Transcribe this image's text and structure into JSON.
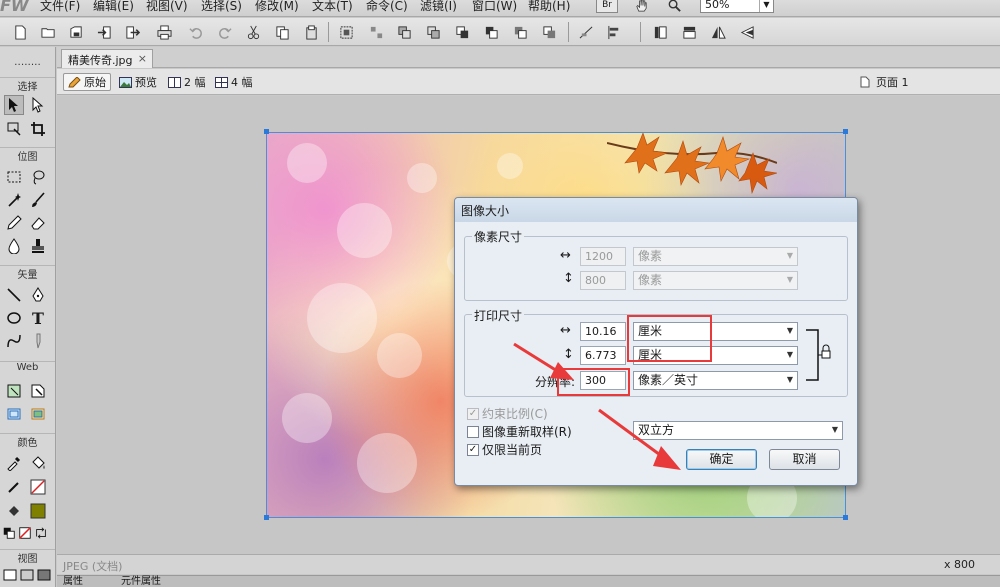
{
  "menubar": {
    "logo": "FW",
    "items": [
      "文件(F)",
      "编辑(E)",
      "视图(V)",
      "选择(S)",
      "修改(M)",
      "文本(T)",
      "命令(C)",
      "滤镜(I)",
      "窗口(W)",
      "帮助(H)"
    ],
    "bridge_label": "Br",
    "zoom": "50%"
  },
  "document": {
    "tab_title": "精美传奇.jpg",
    "views": [
      "原始",
      "预览",
      "2 幅",
      "4 幅"
    ],
    "page": "页面 1"
  },
  "tool_panel": {
    "sections": [
      "选择",
      "位图",
      "矢量",
      "Web",
      "颜色",
      "视图"
    ]
  },
  "dialog": {
    "title": "图像大小",
    "pixel_group": "像素尺寸",
    "pixel_width": "1200",
    "pixel_height": "800",
    "pixel_unit": "像素",
    "print_group": "打印尺寸",
    "print_width": "10.16",
    "print_height": "6.773",
    "print_unit": "厘米",
    "resolution_label": "分辨率:",
    "resolution_value": "300",
    "resolution_unit": "像素／英寸",
    "constrain_label": "约束比例(C)",
    "resample_label": "图像重新取样(R)",
    "resample_method": "双立方",
    "current_page_label": "仅限当前页",
    "ok_label": "确定",
    "cancel_label": "取消"
  },
  "status": {
    "left": "JPEG (文档)",
    "right": "x 800"
  },
  "panels": [
    "属性",
    "元件属性"
  ],
  "colors": {
    "annotation_red": "#e83a3a",
    "selection_blue": "#2b7ad9"
  }
}
